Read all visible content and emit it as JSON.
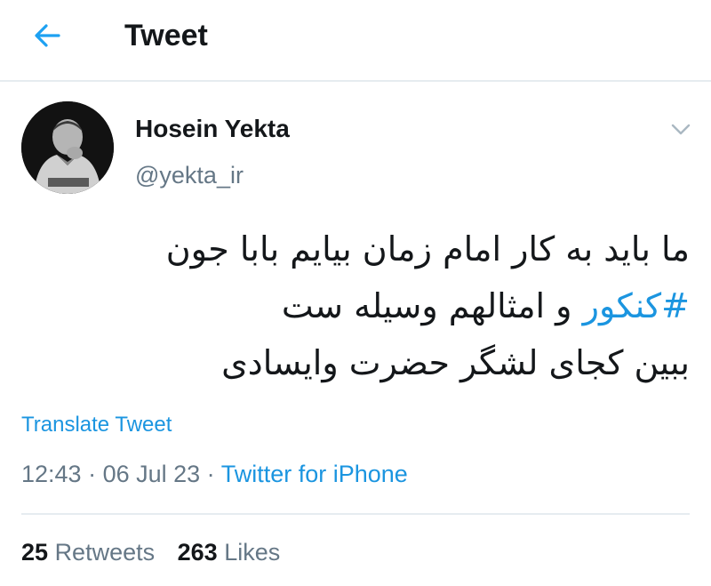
{
  "header": {
    "title": "Tweet",
    "back_icon": "arrow-left-icon",
    "accent_color": "#1da1f2"
  },
  "author": {
    "name": "Hosein Yekta",
    "handle": "@yekta_ir",
    "avatar_icon": "avatar-photo",
    "menu_icon": "chevron-down-icon"
  },
  "tweet": {
    "line1": "ما باید به کار امام زمان بیایم بابا جون",
    "line2_hashtag": "#کنکور",
    "line2_rest": " و امثالهم وسیله ست",
    "line3": "ببین کجای لشگر حضرت وایسادی"
  },
  "translate_label": "Translate Tweet",
  "meta": {
    "time": "12:43",
    "sep1": " · ",
    "date": "06 Jul 23",
    "sep2": " · ",
    "source": "Twitter for iPhone"
  },
  "stats": {
    "retweets_count": "25",
    "retweets_label": "Retweets",
    "likes_count": "263",
    "likes_label": "Likes"
  },
  "colors": {
    "link": "#1b95e0",
    "secondary_text": "#657786",
    "divider": "#e6ecf0"
  }
}
